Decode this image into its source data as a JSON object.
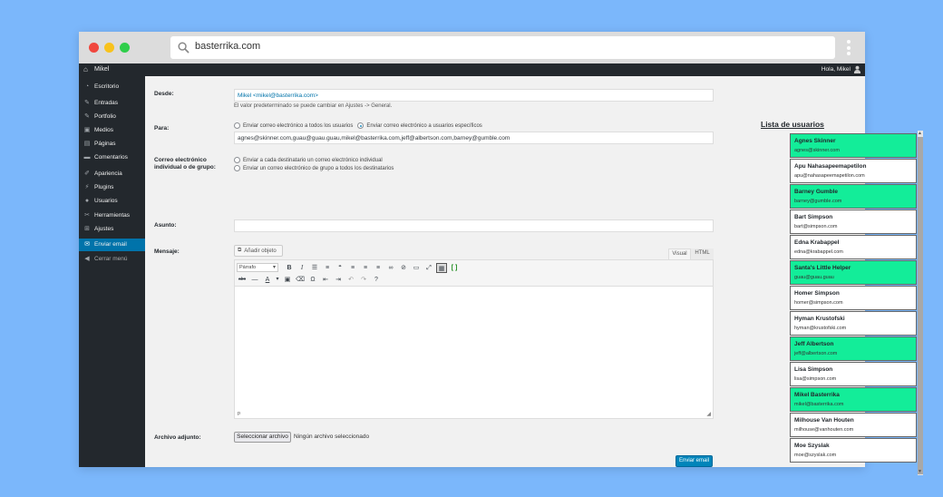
{
  "browser": {
    "url": "basterrika.com",
    "icons": [
      "search-icon",
      "kebab-menu-icon"
    ]
  },
  "adminbar": {
    "site_name": "Mikel",
    "greeting": "Hola, Mikel"
  },
  "sidebar": {
    "items": [
      {
        "label": "Escritorio",
        "icon": "dashboard-icon"
      },
      {
        "label": "Entradas",
        "icon": "pin-icon"
      },
      {
        "label": "Portfolio",
        "icon": "pin-icon"
      },
      {
        "label": "Medios",
        "icon": "media-icon"
      },
      {
        "label": "Páginas",
        "icon": "page-icon"
      },
      {
        "label": "Comentarios",
        "icon": "comment-icon"
      },
      {
        "label": "Apariencia",
        "icon": "brush-icon"
      },
      {
        "label": "Plugins",
        "icon": "plugin-icon"
      },
      {
        "label": "Usuarios",
        "icon": "users-icon"
      },
      {
        "label": "Herramientas",
        "icon": "wrench-icon"
      },
      {
        "label": "Ajustes",
        "icon": "settings-icon"
      },
      {
        "label": "Enviar email",
        "icon": "email-icon",
        "active": true
      },
      {
        "label": "Cerrar menú",
        "icon": "collapse-icon"
      }
    ]
  },
  "form": {
    "from": {
      "label": "Desde:",
      "value": "Mikel <mikel@basterrika.com>",
      "description": "El valor predeterminado se puede cambiar en Ajustes -> General."
    },
    "to": {
      "label": "Para:",
      "option_all": "Enviar correo electrónico a todos los usuarios",
      "option_specific": "Enviar correo electrónico a usuarios específicos",
      "value": "agnes@skinner.com,guau@guau.guau,mikel@basterrika.com,jeff@albertson.com,barney@gumble.com"
    },
    "mode": {
      "label_line1": "Correo electrónico",
      "label_line2": "individual o de grupo:",
      "option_individual": "Enviar a cada destinatario un correo electrónico individual",
      "option_group": "Enviar un correo electrónico de grupo a todos los destinatarios"
    },
    "subject": {
      "label": "Asunto:",
      "value": ""
    },
    "message": {
      "label": "Mensaje:",
      "add_media": "Añadir objeto",
      "tab_visual": "Visual",
      "tab_html": "HTML",
      "format_select": "Párrafo",
      "path": "p"
    },
    "attachment": {
      "label": "Archivo adjunto:",
      "button": "Seleccionar archivo",
      "status": "Ningún archivo seleccionado"
    },
    "send_button": "Enviar email"
  },
  "userlist": {
    "title": "Lista de usuarios",
    "selected_color": "#13ed99",
    "users": [
      {
        "name": "Agnes Skinner",
        "email": "agnes@skinner.com",
        "selected": true
      },
      {
        "name": "Apu Nahasapeemapetilon",
        "email": "apu@nahasapeemapetilon.com",
        "selected": false
      },
      {
        "name": "Barney Gumble",
        "email": "barney@gumble.com",
        "selected": true
      },
      {
        "name": "Bart Simpson",
        "email": "bart@simpson.com",
        "selected": false
      },
      {
        "name": "Edna Krabappel",
        "email": "edna@krabappel.com",
        "selected": false
      },
      {
        "name": "Santa's Little Helper",
        "email": "guau@guau.guau",
        "selected": true
      },
      {
        "name": "Homer Simpson",
        "email": "homer@simpson.com",
        "selected": false
      },
      {
        "name": "Hyman Krustofski",
        "email": "hyman@krustofski.com",
        "selected": false
      },
      {
        "name": "Jeff Albertson",
        "email": "jeff@albertson.com",
        "selected": true
      },
      {
        "name": "Lisa Simpson",
        "email": "lisa@simpson.com",
        "selected": false
      },
      {
        "name": "Mikel Basterrika",
        "email": "mikel@basterrika.com",
        "selected": true
      },
      {
        "name": "Milhouse Van Houten",
        "email": "milhouse@vanhouten.com",
        "selected": false
      },
      {
        "name": "Moe Szyslak",
        "email": "moe@szyslak.com",
        "selected": false
      }
    ]
  }
}
